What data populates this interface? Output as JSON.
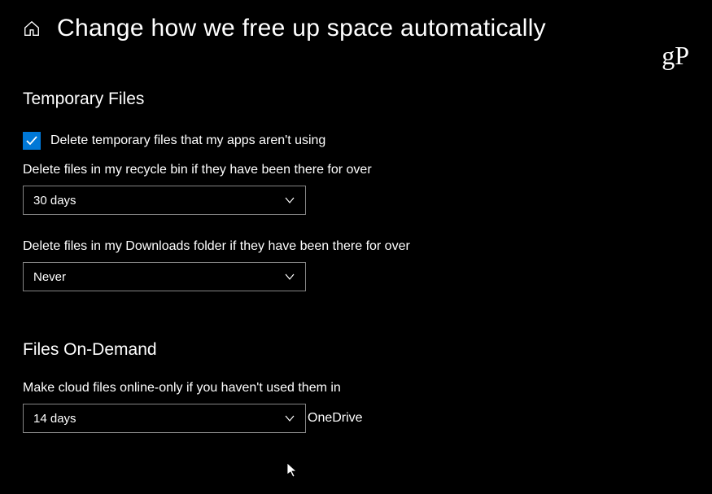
{
  "header": {
    "title": "Change how we free up space automatically"
  },
  "watermark": "gP",
  "temporary_files": {
    "heading": "Temporary Files",
    "checkbox_label": "Delete temporary files that my apps aren't using",
    "recycle_label": "Delete files in my recycle bin if they have been there for over",
    "recycle_value": "30 days",
    "downloads_label": "Delete files in my Downloads folder if they have been there for over",
    "downloads_value": "Never"
  },
  "files_on_demand": {
    "heading": "Files On-Demand",
    "cloud_label": "Make cloud files online-only if you haven't used them in",
    "cloud_value": "14 days",
    "onedrive_label": "OneDrive"
  }
}
